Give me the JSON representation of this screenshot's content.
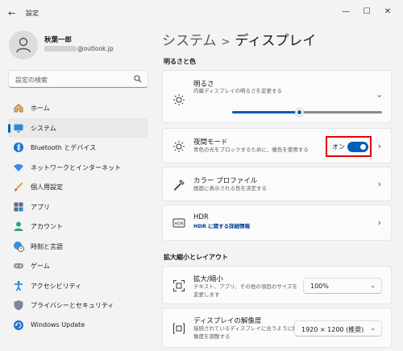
{
  "app": {
    "title": "設定"
  },
  "profile": {
    "name": "秋葉一郎",
    "email_suffix": "@outlook.jp"
  },
  "search": {
    "placeholder": "設定の検索"
  },
  "nav": {
    "items": [
      {
        "label": "ホーム",
        "icon": "home-icon"
      },
      {
        "label": "システム",
        "icon": "system-icon"
      },
      {
        "label": "Bluetooth とデバイス",
        "icon": "bluetooth-icon"
      },
      {
        "label": "ネットワークとインターネット",
        "icon": "wifi-icon"
      },
      {
        "label": "個人用設定",
        "icon": "brush-icon"
      },
      {
        "label": "アプリ",
        "icon": "apps-icon"
      },
      {
        "label": "アカウント",
        "icon": "account-icon"
      },
      {
        "label": "時刻と言語",
        "icon": "globe-clock-icon"
      },
      {
        "label": "ゲーム",
        "icon": "gamepad-icon"
      },
      {
        "label": "アクセシビリティ",
        "icon": "accessibility-icon"
      },
      {
        "label": "プライバシーとセキュリティ",
        "icon": "shield-icon"
      },
      {
        "label": "Windows Update",
        "icon": "update-icon"
      }
    ],
    "active_index": 1
  },
  "breadcrumb": {
    "parent": "システム",
    "separator": ">",
    "current": "ディスプレイ"
  },
  "sections": {
    "brightness_color": "明るさと色",
    "scale_layout": "拡大縮小とレイアウト"
  },
  "brightness": {
    "title": "明るさ",
    "subtitle": "内蔵ディスプレイの明るさを変更する",
    "level": 0.45
  },
  "night_light": {
    "title": "夜間モード",
    "subtitle": "青色の光をブロックするために、暖色を使用する",
    "state_label": "オン",
    "on": true
  },
  "color_profile": {
    "title": "カラー プロファイル",
    "subtitle": "画面に表示される色を決定する"
  },
  "hdr": {
    "title": "HDR",
    "subtitle": "HDR に関する詳細情報"
  },
  "scale": {
    "title": "拡大/縮小",
    "subtitle_line1": "テキスト、アプリ、その他の項目のサイズを",
    "subtitle_line2": "変更します",
    "value": "100%"
  },
  "resolution": {
    "title": "ディスプレイの解像度",
    "subtitle_line1": "接続されているディスプレイに合うように解",
    "subtitle_line2": "像度を調整する",
    "value": "1920 × 1200 (推奨)"
  },
  "colors": {
    "accent": "#005fb8",
    "highlight_border": "#e60000"
  }
}
